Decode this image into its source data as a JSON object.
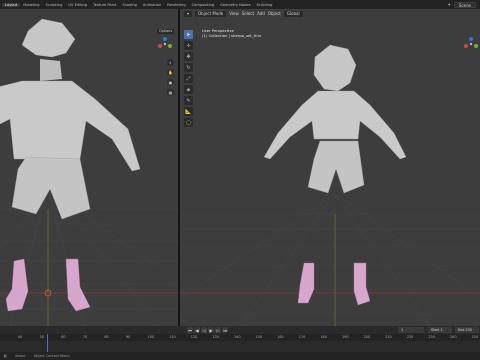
{
  "workspace_tabs": [
    "Layout",
    "Modeling",
    "Sculpting",
    "UV Editing",
    "Texture Paint",
    "Shading",
    "Animation",
    "Rendering",
    "Compositing",
    "Geometry Nodes",
    "Scripting"
  ],
  "scene": {
    "label": "Scene"
  },
  "left_viewport": {
    "options_label": "Options"
  },
  "right_viewport": {
    "mode": "Object Mode",
    "menus": [
      "View",
      "Select",
      "Add",
      "Object"
    ],
    "orientation": "Global",
    "overlay_title": "User Perspective",
    "overlay_collection": "(1) Collection | sherpa_set_thin"
  },
  "timeline": {
    "ruler_ticks": [
      "40",
      "50",
      "60",
      "70",
      "80",
      "90",
      "100",
      "110",
      "120",
      "130",
      "140",
      "150",
      "160",
      "170",
      "180",
      "190",
      "200",
      "210",
      "220",
      "230",
      "240",
      "250"
    ],
    "current_frame": "1",
    "start_label": "Start",
    "start_value": "1",
    "end_label": "End",
    "end_value": "250"
  },
  "status": {
    "left": "Select",
    "middle": "Object Context Menu"
  },
  "colors": {
    "viewport_bg": "#3d3d3d",
    "grid": "#4a4a4a",
    "x_axis": "#8a3a3a",
    "y_axis": "#6a8a2a",
    "clothing": "#c9c9c9",
    "boots": "#d7a6cc",
    "accent": "#4772b3"
  }
}
